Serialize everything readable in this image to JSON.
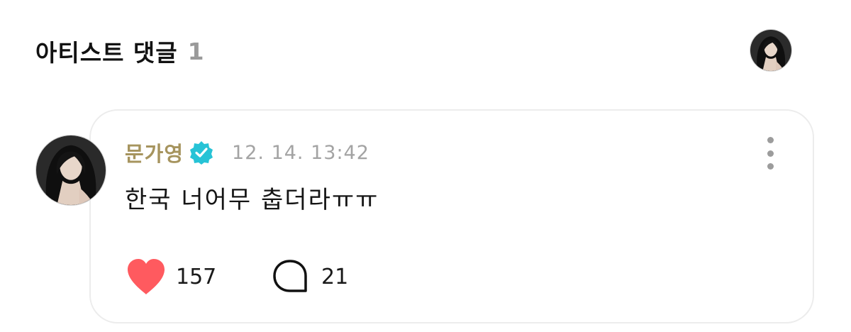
{
  "section": {
    "title": "아티스트 댓글",
    "count": "1"
  },
  "comment": {
    "author": "문가영",
    "verified": true,
    "timestamp": "12. 14. 13:42",
    "text": "한국 너어무 춥더라ㅠㅠ",
    "likes": "157",
    "replies": "21"
  },
  "icons": {
    "avatar": "artist-profile-photo",
    "verified": "verified-badge-icon",
    "more": "more-vertical-icon",
    "like": "heart-icon",
    "reply": "speech-bubble-icon"
  },
  "colors": {
    "author_name": "#a6945e",
    "verified_badge": "#27c3d6",
    "heart": "#ff5a5f",
    "timestamp": "#a3a3a3",
    "count_muted": "#9a9a9a"
  }
}
